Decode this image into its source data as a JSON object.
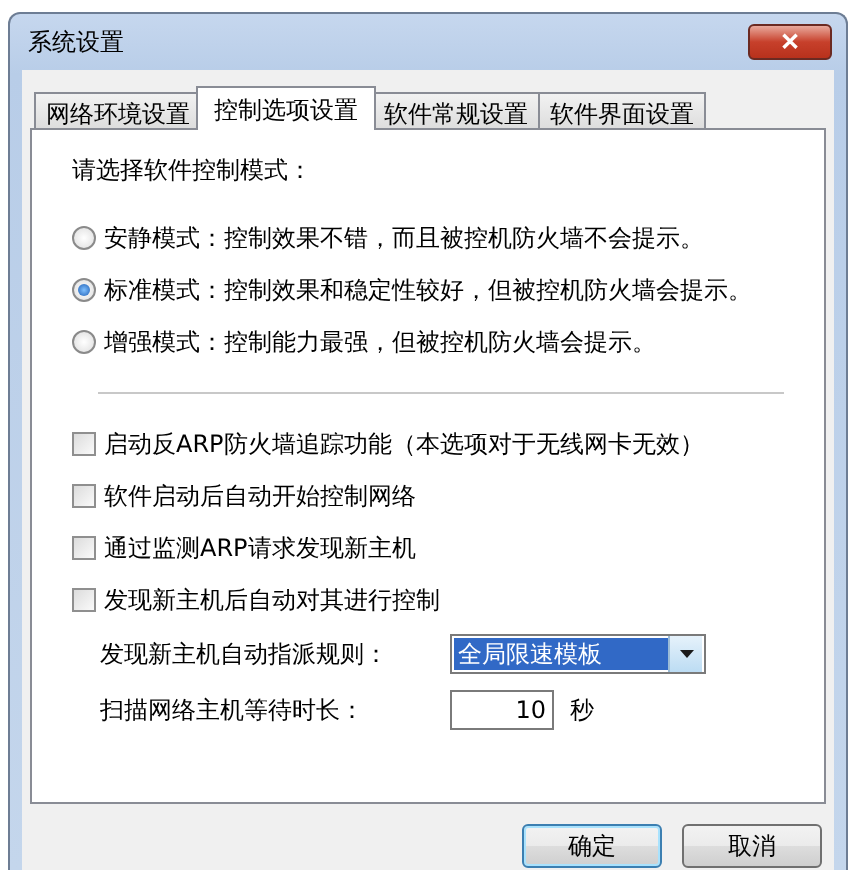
{
  "window": {
    "title": "系统设置",
    "close": "✕"
  },
  "tabs": [
    {
      "label": "网络环境设置",
      "selected": false
    },
    {
      "label": "控制选项设置",
      "selected": true
    },
    {
      "label": "软件常规设置",
      "selected": false
    },
    {
      "label": "软件界面设置",
      "selected": false
    }
  ],
  "mode_prompt": "请选择软件控制模式：",
  "modes": [
    {
      "label": "安静模式：控制效果不错，而且被控机防火墙不会提示。",
      "selected": false
    },
    {
      "label": "标准模式：控制效果和稳定性较好，但被控机防火墙会提示。",
      "selected": true
    },
    {
      "label": "增强模式：控制能力最强，但被控机防火墙会提示。",
      "selected": false
    }
  ],
  "options": [
    {
      "label": "启动反ARP防火墙追踪功能（本选项对于无线网卡无效）",
      "checked": false
    },
    {
      "label": "软件启动后自动开始控制网络",
      "checked": false
    },
    {
      "label": "通过监测ARP请求发现新主机",
      "checked": false
    },
    {
      "label": "发现新主机后自动对其进行控制",
      "checked": false
    }
  ],
  "assign_rule": {
    "label": "发现新主机自动指派规则：",
    "value": "全局限速模板"
  },
  "scan_wait": {
    "label": "扫描网络主机等待时长：",
    "value": "10",
    "unit": "秒"
  },
  "buttons": [
    "确定",
    "取消"
  ]
}
